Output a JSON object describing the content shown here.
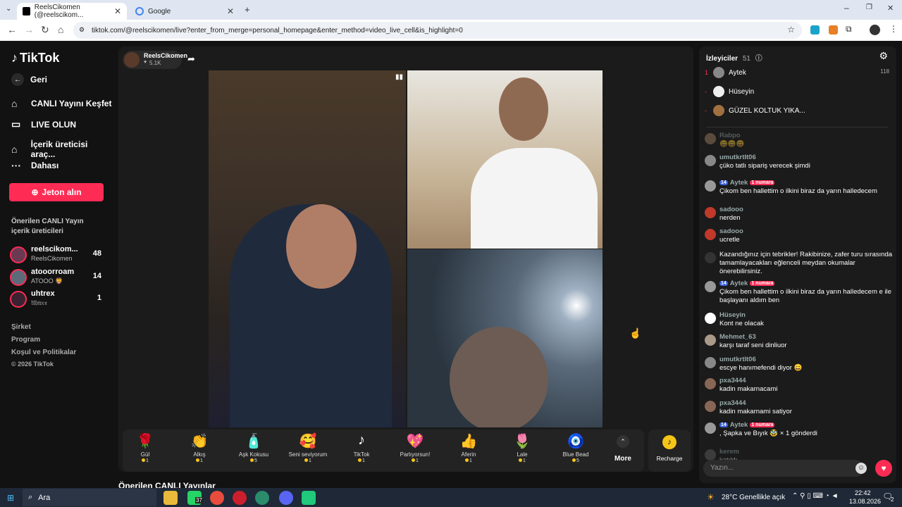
{
  "browser": {
    "tabs": [
      {
        "title": "ReelsCikomen (@reelscikom..."
      },
      {
        "title": "Google"
      }
    ],
    "url": "tiktok.com/@reelscikomen/live?enter_from_merge=personal_homepage&enter_method=video_live_cell&is_highlight=0"
  },
  "sidebar": {
    "logo": "TikTok",
    "back": "Geri",
    "nav": [
      {
        "label": "CANLI Yayını Keşfet",
        "icon": "compass-icon"
      },
      {
        "label": "LIVE OLUN",
        "icon": "video-icon"
      },
      {
        "label": "İçerik üreticisi araç...",
        "icon": "creator-tools-icon"
      },
      {
        "label": "Dahası",
        "icon": "more-dots-icon"
      }
    ],
    "jeton": "Jeton alın",
    "section_title": "Önerilen CANLI Yayın içerik üreticileri",
    "creators": [
      {
        "name": "reelscikom...",
        "sub": "ReelsCikomen",
        "count": "48"
      },
      {
        "name": "atooorroam",
        "sub": "ATOOO 🦁",
        "count": "14"
      },
      {
        "name": "uhtrex",
        "sub": "𝔘𝔥𝔱𝔯𝔢𝔵",
        "count": "1"
      }
    ],
    "footer": [
      "Şirket",
      "Program",
      "Koşul ve Politikalar",
      "© 2026 TikTok"
    ]
  },
  "live": {
    "host_name": "ReelsCikomen",
    "host_likes": "5.1K",
    "gifts": [
      {
        "name": "Gül",
        "price": "1",
        "icon": "🌹"
      },
      {
        "name": "Alkış",
        "price": "1",
        "icon": "👏"
      },
      {
        "name": "Aşk Kokusu",
        "price": "5",
        "icon": "🧴"
      },
      {
        "name": "Seni seviyorum",
        "price": "1",
        "icon": "🥰"
      },
      {
        "name": "TikTok",
        "price": "1",
        "icon": "♪"
      },
      {
        "name": "Parlıyorsun!",
        "price": "1",
        "icon": "💖"
      },
      {
        "name": "Aferin",
        "price": "1",
        "icon": "👍"
      },
      {
        "name": "Lale",
        "price": "1",
        "icon": "🌷"
      },
      {
        "name": "Blue Bead",
        "price": "5",
        "icon": "🧿"
      }
    ],
    "more_label": "More",
    "recharge_label": "Recharge",
    "below_title": "Önerilen CANLI Yayınlar"
  },
  "chat": {
    "title": "İzleyiciler",
    "viewer_count": "51",
    "top_viewers": [
      {
        "rank": "1",
        "name": "Aytek",
        "score": "118"
      },
      {
        "rank": "-",
        "name": "Hüseyin",
        "score": ""
      },
      {
        "rank": "-",
        "name": "GÜZEL KOLTUK YIKA...",
        "score": ""
      }
    ],
    "messages": [
      {
        "user": "Rabpo",
        "text": "😄😄😄"
      },
      {
        "user": "umutkrtlt06",
        "text": "çüko tatlı sipariş verecek şimdi"
      },
      {
        "user": "Aytek",
        "badge": "14",
        "rank_badge": "1 numara",
        "text": "Çikom ben hallettim o ilkini biraz da yarın halledecem"
      },
      {
        "user": "sadooo",
        "text": "nerden"
      },
      {
        "user": "sadooo",
        "text": "ucretle"
      },
      {
        "user": "",
        "text": "Kazandığınız için tebrikler! Rakibinize, zafer turu sırasında tamamlayacakları eğlenceli meydan okumalar önerebilirsiniz."
      },
      {
        "user": "Aytek",
        "badge": "14",
        "rank_badge": "1 numara",
        "text": "Çikom ben hallettim o ilkini biraz da yarın halledecem e ile başlayanı aldım ben"
      },
      {
        "user": "Hüseyin",
        "text": "Kont ne olacak"
      },
      {
        "user": "Mehmet_63",
        "text": "karşı taraf seni dinliuor"
      },
      {
        "user": "umutkrtlt06",
        "text": "escye hanımefendi diyor 😄"
      },
      {
        "user": "pxa3444",
        "text": "kadin makarnacami"
      },
      {
        "user": "pxa3444",
        "text": "kadin makarnami satiyor"
      },
      {
        "user": "Aytek",
        "badge": "14",
        "rank_badge": "1 numara",
        "text": ", Şapka ve Bıyık 🥸 × 1 gönderdi"
      },
      {
        "user": "kerem",
        "text": "katıldı"
      }
    ],
    "input_placeholder": "Yazın..."
  },
  "taskbar": {
    "search": "Ara",
    "weather": "28°C  Genellikle açık",
    "time": "22:42",
    "date": "13.08.2026",
    "whatsapp_badge": "37",
    "notif": "2"
  }
}
